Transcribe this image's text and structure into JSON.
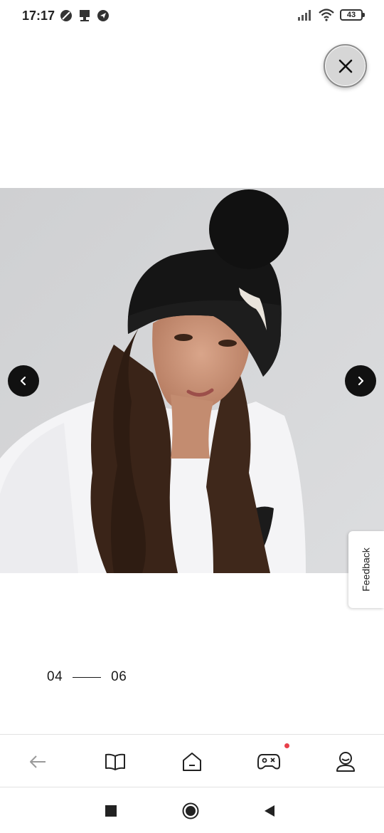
{
  "status_bar": {
    "time": "17:17",
    "battery": "43"
  },
  "close_button": {
    "icon": "close-icon"
  },
  "gallery": {
    "image_description": "product-photo-beanie",
    "prev_icon": "chevron-left-icon",
    "next_icon": "chevron-right-icon",
    "current": "04",
    "total": "06"
  },
  "feedback": {
    "label": "Feedback"
  },
  "bottom_nav": {
    "items": [
      {
        "icon": "back-arrow-icon"
      },
      {
        "icon": "book-icon"
      },
      {
        "icon": "home-icon"
      },
      {
        "icon": "gamepad-icon",
        "has_notification": true
      },
      {
        "icon": "profile-icon"
      }
    ],
    "notification_color": "#e8404a"
  },
  "system_nav": {
    "items": [
      {
        "icon": "square-recents-icon"
      },
      {
        "icon": "circle-home-icon"
      },
      {
        "icon": "triangle-back-icon"
      }
    ]
  }
}
